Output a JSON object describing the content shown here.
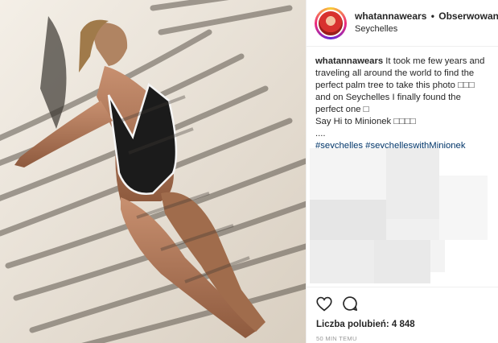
{
  "post": {
    "username": "whatannawears",
    "separator": "•",
    "follow_label": "Obserwowanie",
    "location": "Seychelles"
  },
  "caption": {
    "username": "whatannawears",
    "line1": " It took me few years and traveling all around the world to find the perfect palm tree to take this photo □□□ and on Seychelles I finally found the perfect one □",
    "line2": "Say Hi to Minionek □□□□",
    "line3": "....",
    "hashtags": "#seychelles #seychelleswithMinionek"
  },
  "actions": {
    "like_icon": "heart-icon",
    "comment_icon": "comment-icon",
    "likes_text": "Liczba polubień: 4 848",
    "time_text": "50 MIN TEMU"
  },
  "colors": {
    "text": "#262626",
    "hashtag": "#003569",
    "muted": "#999999",
    "border": "#efefef"
  }
}
